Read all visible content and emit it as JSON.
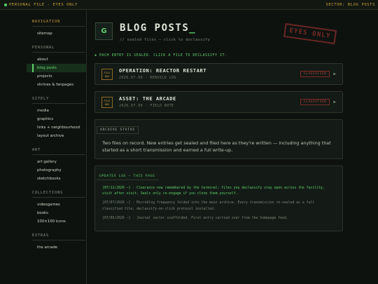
{
  "topbar": {
    "left_label": "PERSONAL FILE - EYES ONLY",
    "right_label": "SECTOR: BLOG POSTS"
  },
  "sidebar": {
    "sections": [
      {
        "title": "NAVIGATION",
        "items": [
          {
            "label": "sitemap"
          }
        ]
      },
      {
        "title": "PERSONAL",
        "items": [
          {
            "label": "about"
          },
          {
            "label": "blog posts"
          },
          {
            "label": "projects"
          },
          {
            "label": "shrines & fanpages"
          }
        ]
      },
      {
        "title": "SITELY",
        "items": [
          {
            "label": "media"
          },
          {
            "label": "graphics"
          },
          {
            "label": "links + neighbourhood"
          },
          {
            "label": "layout archive"
          }
        ]
      },
      {
        "title": "ART",
        "items": [
          {
            "label": "art gallery"
          },
          {
            "label": "photography"
          },
          {
            "label": "sketchbooks"
          }
        ]
      },
      {
        "title": "COLLECTIONS",
        "items": [
          {
            "label": "videogames"
          },
          {
            "label": "books"
          },
          {
            "label": "100×100 icons"
          }
        ]
      },
      {
        "title": "EXTRAS",
        "items": [
          {
            "label": "the arcade"
          }
        ]
      }
    ],
    "active": "blog posts"
  },
  "header": {
    "logo_letter": "G",
    "title": "BLOG POSTS",
    "cursor": "_",
    "subtitle": "// sealed files — click to declassify",
    "stamp": "EYES ONLY"
  },
  "intro": "EACH ENTRY IS SEALED. CLICK A FILE TO DECLASSIFY IT.",
  "entries": [
    {
      "badge_line1": "FILE",
      "badge_line2": "001",
      "title": "OPERATION: REACTOR RESTART",
      "meta": "2026.07.06 · REBUILD LOG",
      "status": "CLASSIFIED"
    },
    {
      "badge_line1": "FILE",
      "badge_line2": "002",
      "title": "ASSET: THE ARCADE",
      "meta": "2026.07.06 · FIELD NOTE",
      "status": "CLASSIFIED"
    }
  ],
  "archive": {
    "label": "ARCHIVE STATUS",
    "body": "Two files on record. New entries get sealed and filed here as they're written — including anything that started as a short transmission and earned a full write-up."
  },
  "updates": {
    "label": "UPDATES LOG — THIS PAGE",
    "entries": [
      {
        "text": "[07/12/2026 —] · Clearance now remembered by the terminal: files you declassify stay open across the facility, visit after visit. Seals only re-engage if you close them yourself.",
        "state": "new"
      },
      {
        "text": "[07/07/2026 —] · Microblog frequency folded into the main archive. Every transmission re-sealed as a full classified file; declassify-on-click protocol installed.",
        "state": "old"
      },
      {
        "text": "[07/06/2026 —] · Journal sector scaffolded. First entry carried over from the homepage feed.",
        "state": "old"
      }
    ]
  }
}
